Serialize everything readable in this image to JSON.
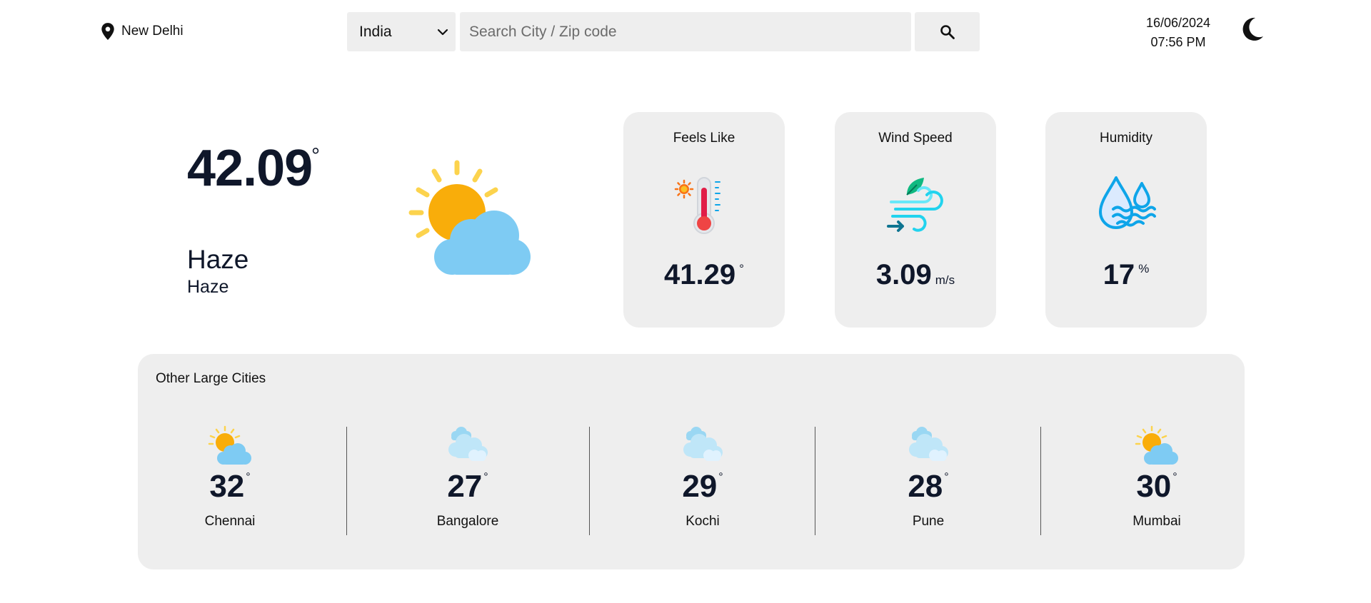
{
  "header": {
    "location": "New Delhi",
    "country_select": {
      "selected": "India"
    },
    "search": {
      "placeholder": "Search City / Zip code",
      "value": ""
    },
    "date": "16/06/2024",
    "time": "07:56 PM",
    "icons": {
      "location": "map-pin-icon",
      "dropdown": "chevron-down-icon",
      "search": "search-icon",
      "theme": "moon-icon"
    }
  },
  "current": {
    "temperature": "42.09",
    "degree_symbol": "°",
    "condition": "Haze",
    "description": "Haze",
    "icon": "sun-cloud-icon"
  },
  "stats": [
    {
      "title": "Feels Like",
      "value": "41.29",
      "unit": "°",
      "icon": "thermometer-icon"
    },
    {
      "title": "Wind Speed",
      "value": "3.09",
      "unit": "m/s",
      "icon": "wind-icon"
    },
    {
      "title": "Humidity",
      "value": "17",
      "unit": "%",
      "icon": "humidity-icon"
    }
  ],
  "other_cities": {
    "title": "Other Large Cities",
    "cities": [
      {
        "name": "Chennai",
        "temperature": "32",
        "degree_symbol": "°",
        "icon": "sun-cloud-icon"
      },
      {
        "name": "Bangalore",
        "temperature": "27",
        "degree_symbol": "°",
        "icon": "clouds-icon"
      },
      {
        "name": "Kochi",
        "temperature": "29",
        "degree_symbol": "°",
        "icon": "clouds-icon"
      },
      {
        "name": "Pune",
        "temperature": "28",
        "degree_symbol": "°",
        "icon": "clouds-icon"
      },
      {
        "name": "Mumbai",
        "temperature": "30",
        "degree_symbol": "°",
        "icon": "sun-cloud-icon"
      }
    ]
  },
  "colors": {
    "card_bg": "#eeeeee",
    "text_dark": "#0f172a",
    "sun": "#f9ad0a",
    "sun_rays": "#fcd34d",
    "cloud": "#7ecbf3"
  }
}
